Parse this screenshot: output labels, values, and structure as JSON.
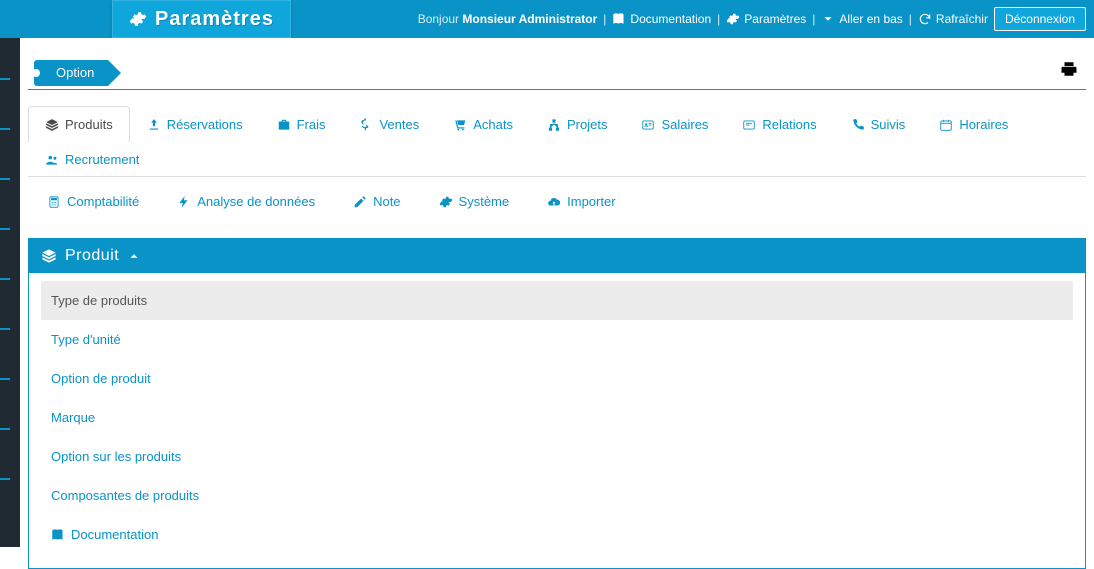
{
  "header": {
    "title": "Paramètres",
    "greeting_prefix": "Bonjour ",
    "user_name": "Monsieur Administrator",
    "links": {
      "documentation": "Documentation",
      "settings": "Paramètres",
      "go_bottom": "Aller en bas",
      "refresh": "Rafraîchir"
    },
    "logout": "Déconnexion"
  },
  "breadcrumb": {
    "label": "Option"
  },
  "tabs_row1": [
    {
      "label": "Produits",
      "icon": "layers",
      "active": true
    },
    {
      "label": "Réservations",
      "icon": "download"
    },
    {
      "label": "Frais",
      "icon": "briefcase"
    },
    {
      "label": "Ventes",
      "icon": "dollar"
    },
    {
      "label": "Achats",
      "icon": "cart"
    },
    {
      "label": "Projets",
      "icon": "sitemap"
    },
    {
      "label": "Salaires",
      "icon": "id"
    },
    {
      "label": "Relations",
      "icon": "card"
    },
    {
      "label": "Suivis",
      "icon": "phone"
    },
    {
      "label": "Horaires",
      "icon": "calendar"
    },
    {
      "label": "Recrutement",
      "icon": "users"
    }
  ],
  "tabs_row2": [
    {
      "label": "Comptabilité",
      "icon": "calc"
    },
    {
      "label": "Analyse de données",
      "icon": "bolt"
    },
    {
      "label": "Note",
      "icon": "pencil"
    },
    {
      "label": "Système",
      "icon": "gear"
    },
    {
      "label": "Importer",
      "icon": "cloud"
    }
  ],
  "panel": {
    "title": "Produit",
    "items": [
      {
        "label": "Type de produits",
        "active": true
      },
      {
        "label": "Type d'unité"
      },
      {
        "label": "Option de produit"
      },
      {
        "label": "Marque"
      },
      {
        "label": "Option sur les produits"
      },
      {
        "label": "Composantes de produits"
      },
      {
        "label": "Documentation",
        "icon": "book"
      }
    ]
  }
}
